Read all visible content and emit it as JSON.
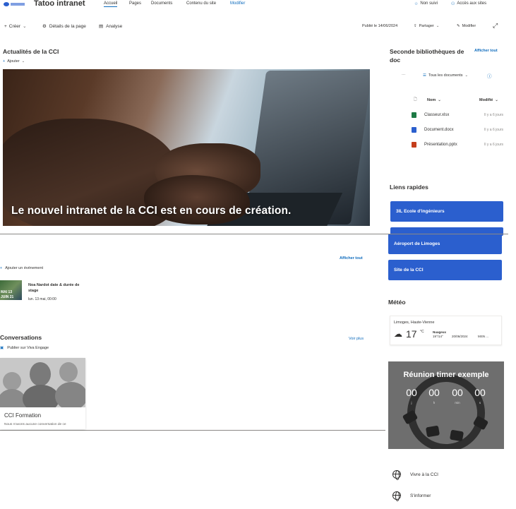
{
  "header": {
    "logo_alt": "CCI logo",
    "site_title": "Tatoo intranet",
    "nav": [
      "Accueil",
      "Pages",
      "Documents",
      "Contenu du site",
      "Modifier"
    ],
    "not_followed": "Non suivi",
    "sites_access": "Accès aux sites"
  },
  "toolbar": {
    "create": "Créer",
    "page_details": "Détails de la page",
    "analytics": "Analyse",
    "published": "Publié le 14/06/2024",
    "share": "Partager",
    "edit": "Modifier"
  },
  "news": {
    "title": "Actualités de la CCI",
    "add": "Ajouter",
    "hero_caption": "Le nouvel intranet de la CCI est en cours de création."
  },
  "doclib": {
    "title": "Seconde bibliothèques de doc",
    "show_all": "Afficher tout",
    "view": "Tous les documents",
    "col_name": "Nom",
    "col_modified": "Modifié",
    "files": [
      {
        "name": "Classeur.xlsx",
        "modified": "Il y a 6 jours",
        "color": "#1d7a45"
      },
      {
        "name": "Document.docx",
        "modified": "Il y a 6 jours",
        "color": "#2b5fce"
      },
      {
        "name": "Présentation.pptx",
        "modified": "Il y a 6 jours",
        "color": "#c43e1c"
      }
    ]
  },
  "quicklinks": {
    "title": "Liens rapides",
    "items": [
      "3IL Ecole d'ingénieurs",
      "Aéroport de Limoges",
      "Site de la CCI"
    ]
  },
  "events": {
    "show_all": "Afficher tout",
    "add": "Ajouter un événement",
    "item": {
      "date_top": "MAI 13",
      "date_bottom": "JUIN 21",
      "title": "Noa Nardot date & durée de stage",
      "when": "lun. 13 mai, 00:00"
    }
  },
  "conversations": {
    "title": "Conversations",
    "post": "Publier sur Viva Engage",
    "see_more": "Voir plus",
    "card_title": "CCI Formation",
    "card_text": "Nous n'avons aucune conversation de ce"
  },
  "weather": {
    "title": "Météo",
    "location": "Limoges, Haute-Vienne",
    "temp": "17",
    "unit": "°C",
    "condition": "Nuageux",
    "range": "19°/14°",
    "date": "20/06/2024",
    "source": "MSN ..."
  },
  "timer": {
    "title": "Réunion timer exemple",
    "values": [
      "00",
      "00",
      "00",
      "00"
    ],
    "labels": [
      "j",
      "h",
      "min",
      "s"
    ]
  },
  "links": [
    "Vivre à la CCI",
    "S'informer"
  ]
}
